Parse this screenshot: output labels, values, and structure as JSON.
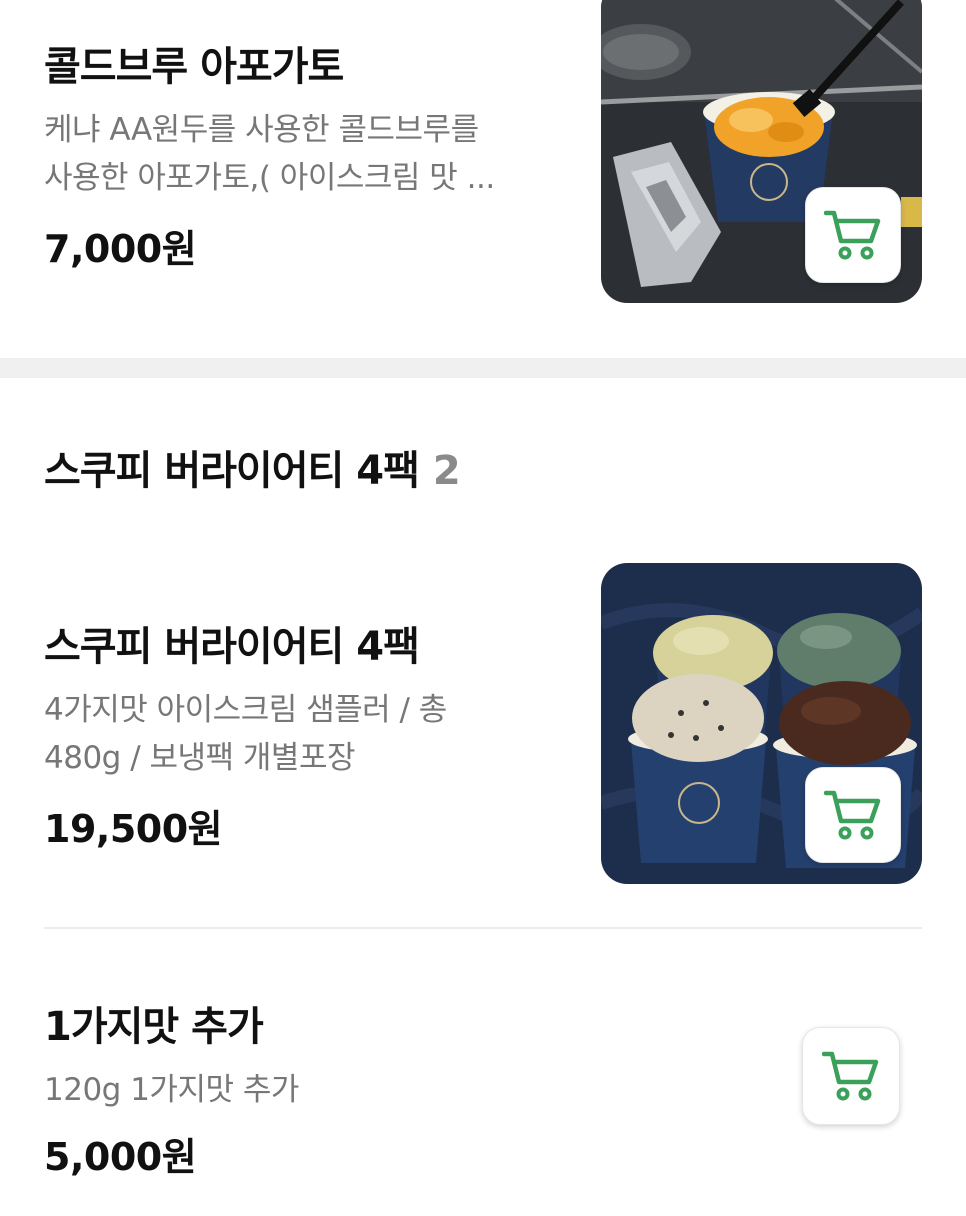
{
  "items_top": {
    "name": "콜드브루 아포가토",
    "desc_lines": [
      "케냐 AA원두를 사용한 콜드브루를",
      "사용한 아포가토,( 아이스크림 맛 ..."
    ],
    "price": "7,000원"
  },
  "section": {
    "title": "스쿠피 버라이어티 4팩",
    "count": "2"
  },
  "items_section": [
    {
      "name": "스쿠피 버라이어티 4팩",
      "desc_lines": [
        "4가지맛 아이스크림 샘플러 / 총",
        "480g / 보냉팩 개별포장"
      ],
      "price": "19,500원"
    },
    {
      "name": "1가지맛 추가",
      "desc_lines": [
        "120g 1가지맛 추가"
      ],
      "price": "5,000원"
    }
  ],
  "icons": {
    "cart": "shopping-cart-icon"
  },
  "colors": {
    "cart_accent": "#3aa05a",
    "section_bg": "#f0f0f0",
    "desc_text": "#777777",
    "count_text": "#8a8a8a"
  }
}
